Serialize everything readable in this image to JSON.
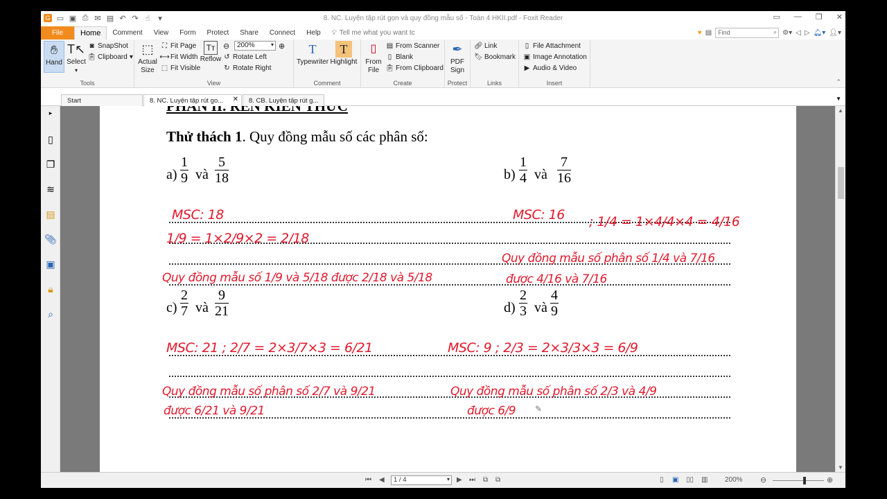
{
  "window": {
    "title": "8. NC. Luyện tập rút gọn và quy đồng mẫu số - Toán 4 HKII.pdf - Foxit Reader"
  },
  "menu": {
    "file": "File",
    "tabs": [
      "Home",
      "Comment",
      "View",
      "Form",
      "Protect",
      "Share",
      "Connect",
      "Help"
    ],
    "tell_me": "Tell me what you want tc",
    "find_placeholder": "Find"
  },
  "ribbon": {
    "tools": {
      "hand": "Hand",
      "select": "Select",
      "snapshot": "SnapShot",
      "clipboard": "Clipboard",
      "label": "Tools"
    },
    "view": {
      "actual_size": "Actual Size",
      "fit_page": "Fit Page",
      "fit_width": "Fit Width",
      "fit_visible": "Fit Visible",
      "reflow": "Reflow",
      "zoom": "200%",
      "rotate_left": "Rotate Left",
      "rotate_right": "Rotate Right",
      "label": "View"
    },
    "comment": {
      "typewriter": "Typewriter",
      "highlight": "Highlight",
      "label": "Comment"
    },
    "create": {
      "from_file": "From File",
      "from_scanner": "From Scanner",
      "blank": "Blank",
      "from_clipboard": "From Clipboard",
      "label": "Create"
    },
    "protect": {
      "pdf_sign": "PDF Sign",
      "label": "Protect"
    },
    "links": {
      "link": "Link",
      "bookmark": "Bookmark",
      "label": "Links"
    },
    "insert": {
      "file_attachment": "File Attachment",
      "image_annotation": "Image Annotation",
      "audio_video": "Audio & Video",
      "label": "Insert"
    }
  },
  "doc_tabs": [
    "Start",
    "8. NC. Luyện tập rút go...",
    "8. CB. Luyện tập rút g..."
  ],
  "document": {
    "header": "PHẦN II. RÈN KIẾN THỨC",
    "challenge_bold": "Thử thách 1",
    "challenge_rest": ". Quy đồng mẫu số các phân số:",
    "problems": [
      {
        "label": "a)",
        "f1": [
          "1",
          "9"
        ],
        "conj": "và",
        "f2": [
          "5",
          "18"
        ]
      },
      {
        "label": "b)",
        "f1": [
          "1",
          "4"
        ],
        "conj": "và",
        "f2": [
          "7",
          "16"
        ]
      },
      {
        "label": "c)",
        "f1": [
          "2",
          "7"
        ],
        "conj": "và",
        "f2": [
          "9",
          "21"
        ]
      },
      {
        "label": "d)",
        "f1": [
          "2",
          "3"
        ],
        "conj": "và",
        "f2": [
          "4",
          "9"
        ]
      }
    ],
    "handwriting": {
      "a_msc": "MSC: 18",
      "a_step": "1/9 = 1×2/9×2 = 2/18",
      "a_concl": "Quy đồng mẫu số 1/9 và 5/18 được 2/18 và 5/18",
      "b_msc": "MSC: 16",
      "b_step": "; 1/4 = 1×4/4×4 = 4/16",
      "b_concl1": "Quy đồng mẫu số phân số 1/4 và 7/16",
      "b_concl2": "được 4/16 và 7/16",
      "c_msc": "MSC: 21 ; 2/7 = 2×3/7×3 = 6/21",
      "c_concl1": "Quy đồng mẫu số phân số 2/7 và 9/21",
      "c_concl2": "được 6/21 và 9/21",
      "d_msc": "MSC: 9 ; 2/3 = 2×3/3×3 = 6/9",
      "d_concl1": "Quy đồng mẫu số phân số 2/3 và 4/9",
      "d_concl2": "được 6/9"
    }
  },
  "status": {
    "page": "1 / 4",
    "zoom": "200%"
  },
  "colors": {
    "accent": "#f28b1e",
    "ink": "#e1192c"
  }
}
